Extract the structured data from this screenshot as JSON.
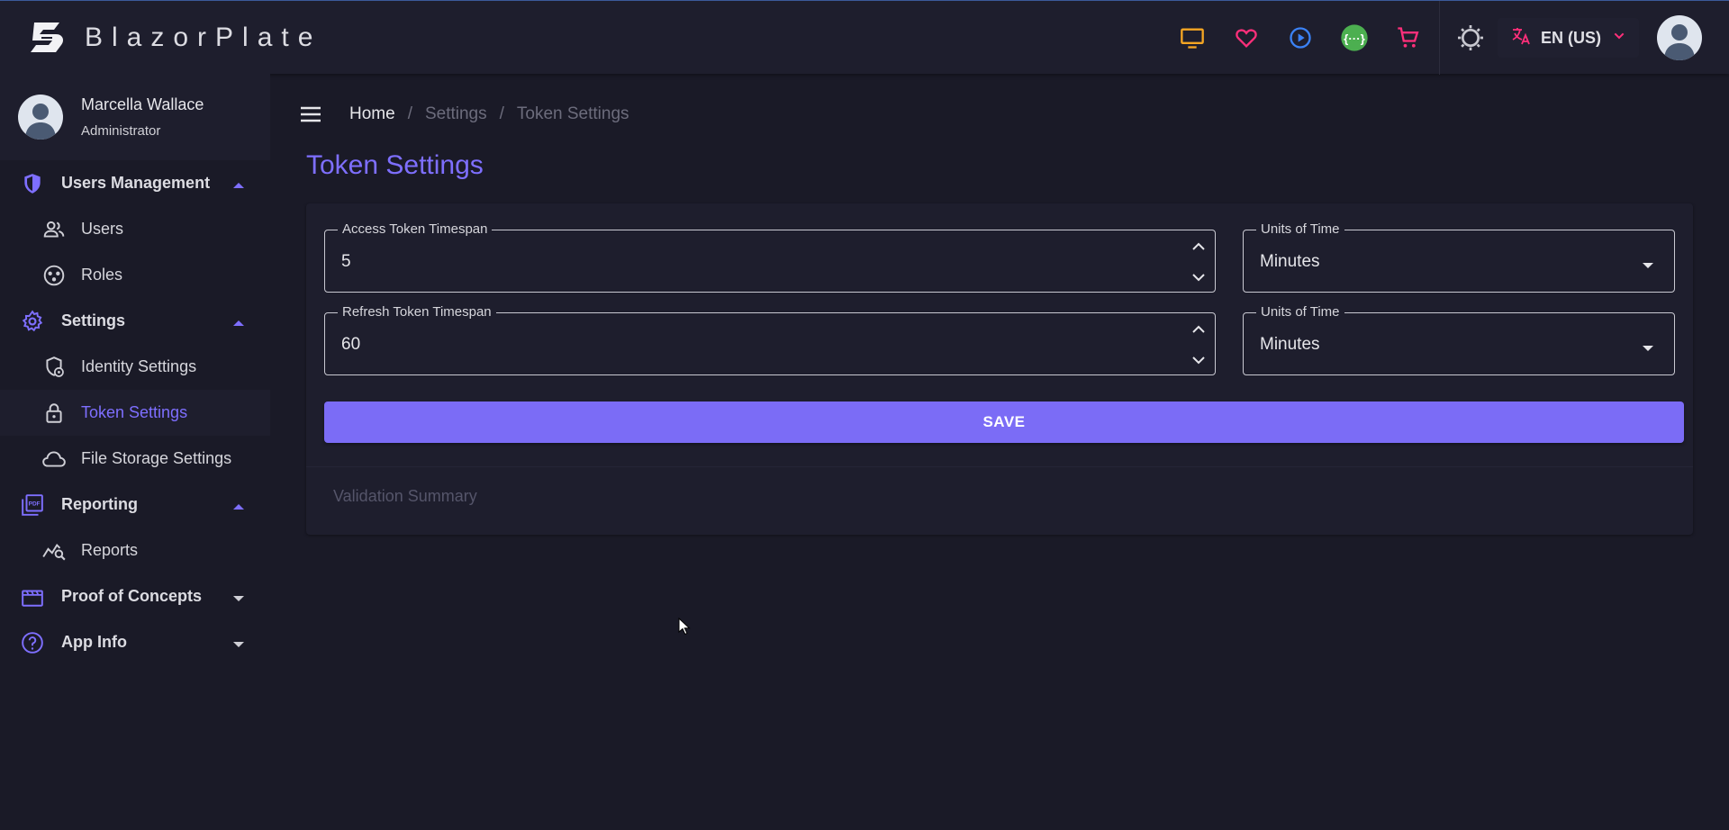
{
  "app": {
    "brand": "BlazorPlate",
    "language": "EN (US)"
  },
  "topbar": {
    "icons": [
      {
        "name": "monitor-icon",
        "color": "#f5a623"
      },
      {
        "name": "heart-icon",
        "color": "#ff2f7a"
      },
      {
        "name": "play-circle-icon",
        "color": "#3b82f6"
      },
      {
        "name": "api-icon",
        "color": "#4caf50"
      },
      {
        "name": "cart-icon",
        "color": "#ff2f7a"
      },
      {
        "name": "theme-toggle-icon",
        "color": "#c8c8d0"
      }
    ],
    "accent_translate": "#ff2f7a"
  },
  "user": {
    "name": "Marcella Wallace",
    "role": "Administrator"
  },
  "sidebar": {
    "groups": [
      {
        "label": "Users Management",
        "icon": "shield-icon",
        "expanded": true,
        "items": [
          {
            "label": "Users",
            "icon": "users-icon"
          },
          {
            "label": "Roles",
            "icon": "roles-icon"
          }
        ]
      },
      {
        "label": "Settings",
        "icon": "gear-icon",
        "expanded": true,
        "items": [
          {
            "label": "Identity Settings",
            "icon": "identity-settings-icon"
          },
          {
            "label": "Token Settings",
            "icon": "lock-icon",
            "active": true
          },
          {
            "label": "File Storage Settings",
            "icon": "cloud-icon"
          }
        ]
      },
      {
        "label": "Reporting",
        "icon": "pdf-icon",
        "expanded": true,
        "items": [
          {
            "label": "Reports",
            "icon": "reports-icon"
          }
        ]
      },
      {
        "label": "Proof of Concepts",
        "icon": "film-icon",
        "expanded": false
      },
      {
        "label": "App Info",
        "icon": "help-icon",
        "expanded": false
      }
    ]
  },
  "breadcrumb": {
    "home": "Home",
    "settings": "Settings",
    "current": "Token Settings"
  },
  "page": {
    "title": "Token Settings"
  },
  "form": {
    "access_label": "Access Token Timespan",
    "access_value": "5",
    "access_unit_label": "Units of Time",
    "access_unit_value": "Minutes",
    "refresh_label": "Refresh Token Timespan",
    "refresh_value": "60",
    "refresh_unit_label": "Units of Time",
    "refresh_unit_value": "Minutes",
    "save_label": "SAVE",
    "validation_summary": "Validation Summary"
  },
  "colors": {
    "accent": "#7e6fff",
    "background": "#1a1a27",
    "surface": "#1e1e2d"
  }
}
